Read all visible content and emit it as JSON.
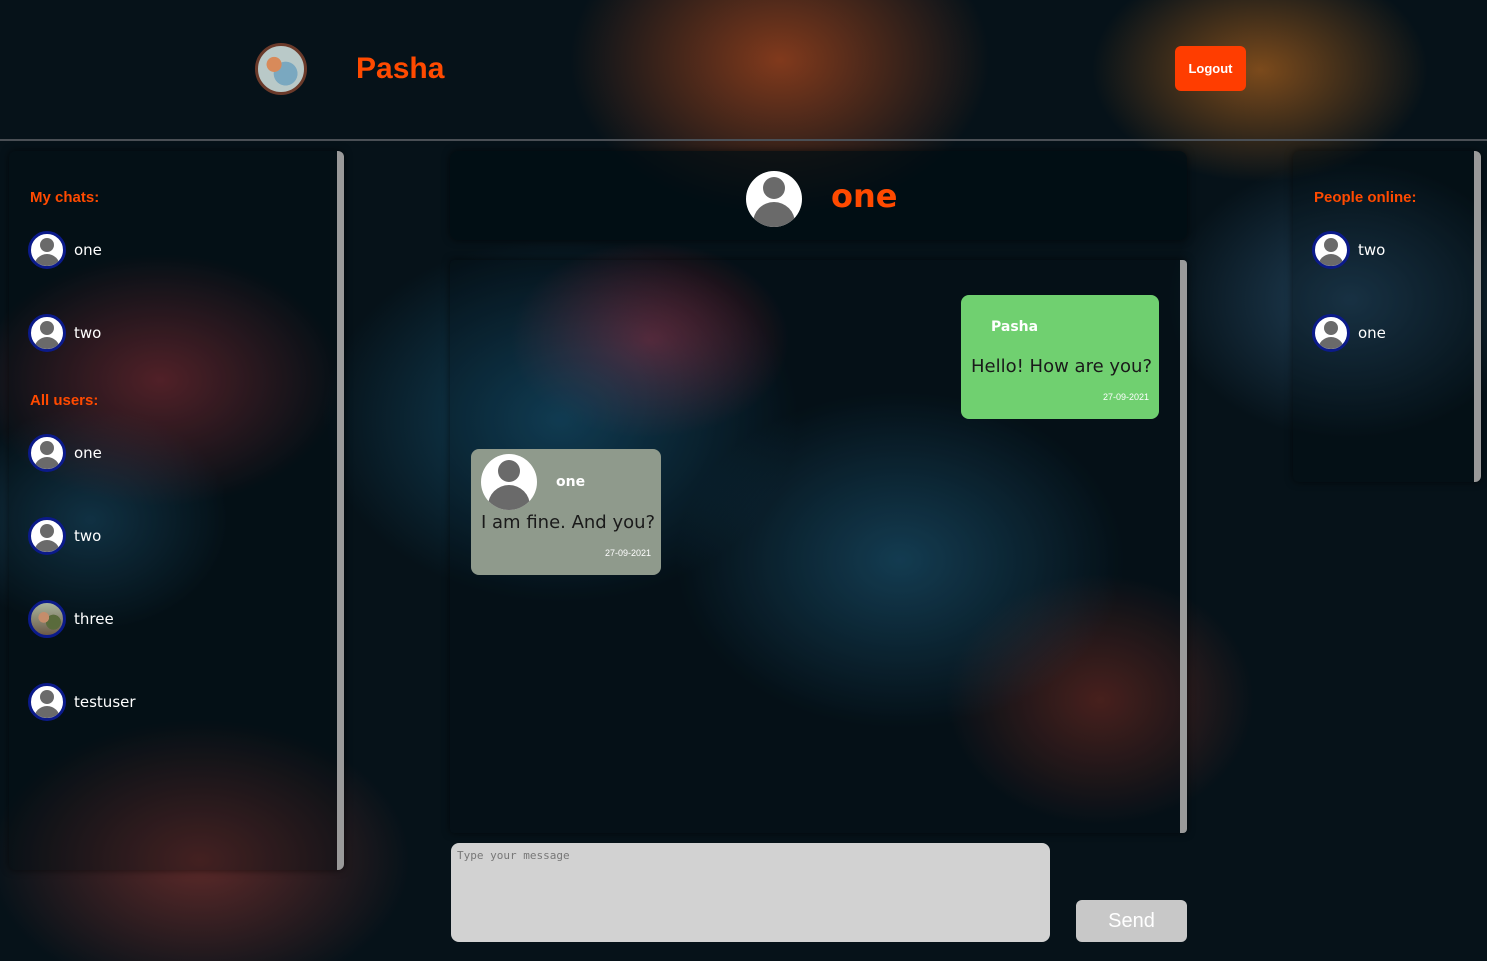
{
  "header": {
    "username": "Pasha",
    "logout_label": "Logout"
  },
  "sidebar_left": {
    "my_chats_title": "My chats:",
    "my_chats": [
      {
        "name": "one",
        "avatar": "default-avatar-icon"
      },
      {
        "name": "two",
        "avatar": "default-avatar-icon"
      }
    ],
    "all_users_title": "All users:",
    "all_users": [
      {
        "name": "one",
        "avatar": "default-avatar-icon"
      },
      {
        "name": "two",
        "avatar": "default-avatar-icon"
      },
      {
        "name": "three",
        "avatar": "photo-avatar"
      },
      {
        "name": "testuser",
        "avatar": "default-avatar-icon"
      }
    ]
  },
  "chat": {
    "partner_name": "one",
    "messages": [
      {
        "sender": "Pasha",
        "text": "Hello! How are you?",
        "date": "27-09-2021",
        "direction": "outgoing",
        "color": "#70d070"
      },
      {
        "sender": "one",
        "text": "I am fine. And you?",
        "date": "27-09-2021",
        "direction": "incoming",
        "color": "#8f9a8c"
      }
    ],
    "input_placeholder": "Type your message",
    "send_label": "Send"
  },
  "sidebar_right": {
    "people_online_title": "People online:",
    "people_online": [
      {
        "name": "two",
        "avatar": "default-avatar-icon"
      },
      {
        "name": "one",
        "avatar": "default-avatar-icon"
      }
    ]
  },
  "colors": {
    "accent": "#ff4a00",
    "logout_button": "#ff3d00",
    "outgoing_bubble": "#70d070",
    "incoming_bubble": "#8f9a8c",
    "send_button": "#c8c8c8",
    "input_background": "#d2d2d2"
  }
}
